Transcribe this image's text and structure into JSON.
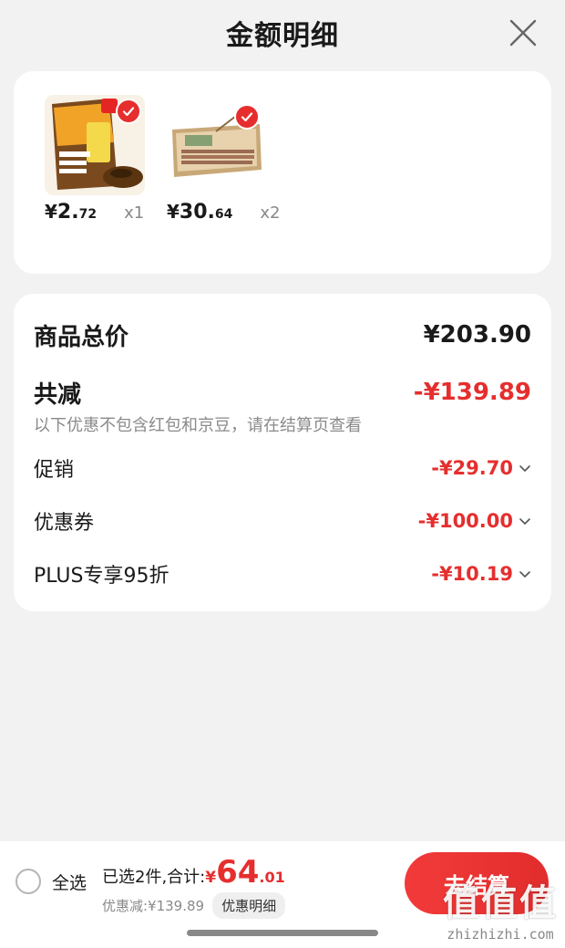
{
  "header": {
    "title": "金额明细"
  },
  "colors": {
    "accent_red": "#e62e2e",
    "background": "#f2f2f2"
  },
  "products": [
    {
      "image_icon": "seasoning-pouch-image",
      "price_symbol": "¥",
      "price_int": "2.",
      "price_dec": "72",
      "qty": "x1"
    },
    {
      "image_icon": "sausage-box-image",
      "price_symbol": "¥",
      "price_int": "30.",
      "price_dec": "64",
      "qty": "x2"
    }
  ],
  "summary": {
    "total_label": "商品总价",
    "total_value": "¥203.90",
    "reduce_label": "共减",
    "reduce_value": "-¥139.89",
    "note": "以下优惠不包含红包和京豆，请在结算页查看",
    "items": [
      {
        "label": "促销",
        "value": "-¥29.70"
      },
      {
        "label": "优惠券",
        "value": "-¥100.00"
      },
      {
        "label": "PLUS专享95折",
        "value": "-¥10.19"
      }
    ]
  },
  "bottom": {
    "select_all": "全选",
    "selected_text": "已选2件,合计:",
    "sum_symbol": "¥",
    "sum_int": "64",
    "sum_dec": ".01",
    "discount_text": "优惠减:¥139.89",
    "detail_tag": "优惠明细",
    "checkout_label": "去结算"
  },
  "watermark": {
    "big": "值值值",
    "small": "zhizhizhi.com"
  }
}
